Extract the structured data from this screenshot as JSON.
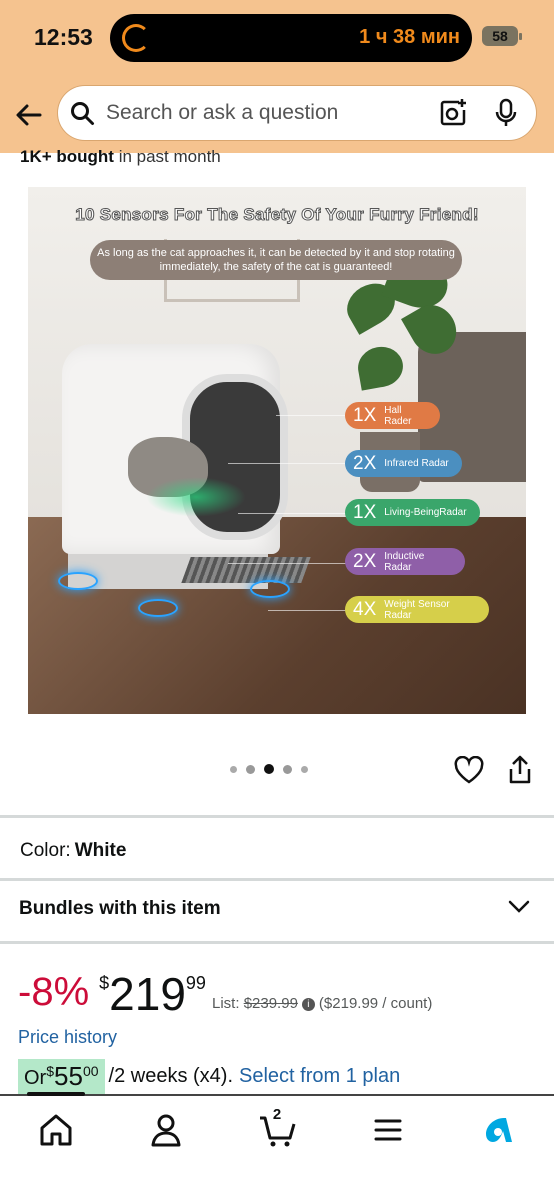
{
  "status_bar": {
    "time": "12:53",
    "timer": "1 ч 38 мин",
    "battery": "58"
  },
  "search": {
    "placeholder": "Search or ask a question"
  },
  "social_proof": {
    "bold": "1K+ bought",
    "rest": " in past month"
  },
  "image": {
    "headline": "10 Sensors For The Safety Of Your Furry Friend!",
    "subhead": "As long as the cat approaches it, it can be detected by it and stop rotating immediately, the safety of the cat is guaranteed!",
    "tags": [
      {
        "count": "1X",
        "label": "Hall Rader",
        "color": "#e07a45"
      },
      {
        "count": "2X",
        "label": "Infrared Radar",
        "color": "#4b8fc0"
      },
      {
        "count": "1X",
        "label": "Living-BeingRadar",
        "color": "#3aa66b"
      },
      {
        "count": "2X",
        "label": "Inductive Radar",
        "color": "#8f5fa8"
      },
      {
        "count": "4X",
        "label": "Weight Sensor Radar",
        "color": "#d6cf4a"
      }
    ],
    "page_dots": 5,
    "active_dot": 3
  },
  "color": {
    "label": "Color:",
    "value": "White"
  },
  "bundles": {
    "label": "Bundles with this item"
  },
  "price": {
    "discount": "-8%",
    "currency": "$",
    "whole": "219",
    "fraction": "99",
    "list_label": "List:",
    "list_price": "$239.99",
    "per_count": "($219.99 / count)",
    "history": "Price history"
  },
  "plan": {
    "prefix": "Or ",
    "currency": "$",
    "whole": "55",
    "fraction": "00",
    "terms": "/2 weeks (x4).",
    "link": "Select from 1 plan"
  },
  "tabbar": {
    "cart_count": "2",
    "accent": "#00a8e1"
  }
}
